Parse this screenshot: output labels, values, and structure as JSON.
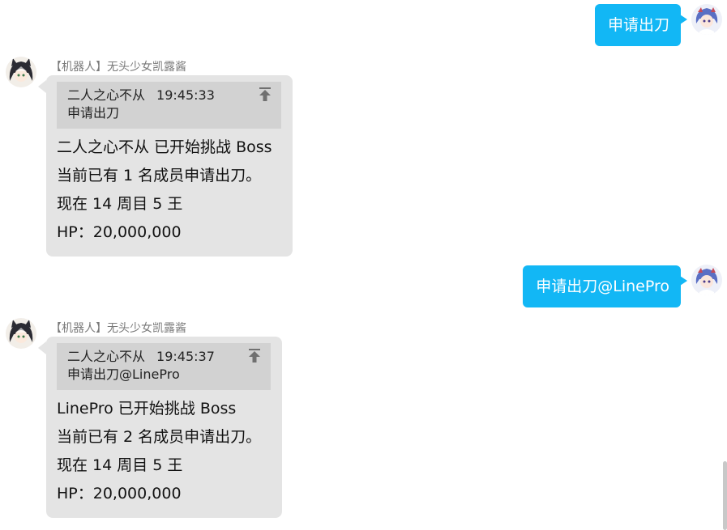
{
  "messages": [
    {
      "text": "申请出刀"
    },
    {
      "sender": "【机器人】无头少女凯露酱",
      "reply": {
        "name": "二人之心不从",
        "time": "19:45:33",
        "text": "申请出刀"
      },
      "lines": [
        "二人之心不从 已开始挑战 Boss",
        "当前已有 1 名成员申请出刀。",
        "现在 14 周目 5 王",
        "HP：20,000,000"
      ]
    },
    {
      "text": "申请出刀@LinePro"
    },
    {
      "sender": "【机器人】无头少女凯露酱",
      "reply": {
        "name": "二人之心不从",
        "time": "19:45:37",
        "text": "申请出刀@LinePro"
      },
      "lines": [
        "LinePro 已开始挑战 Boss",
        "当前已有 2 名成员申请出刀。",
        "现在 14 周目 5 王",
        "HP：20,000,000"
      ]
    }
  ],
  "colors": {
    "outgoing_bubble": "#12b7f5",
    "incoming_bubble": "#e4e4e4",
    "reply_quote": "#d2d2d2"
  },
  "icons": {
    "bot_avatar": "cat-girl-avatar-icon",
    "user_avatar": "blue-hair-girl-avatar-icon",
    "jump": "jump-to-top-icon"
  }
}
